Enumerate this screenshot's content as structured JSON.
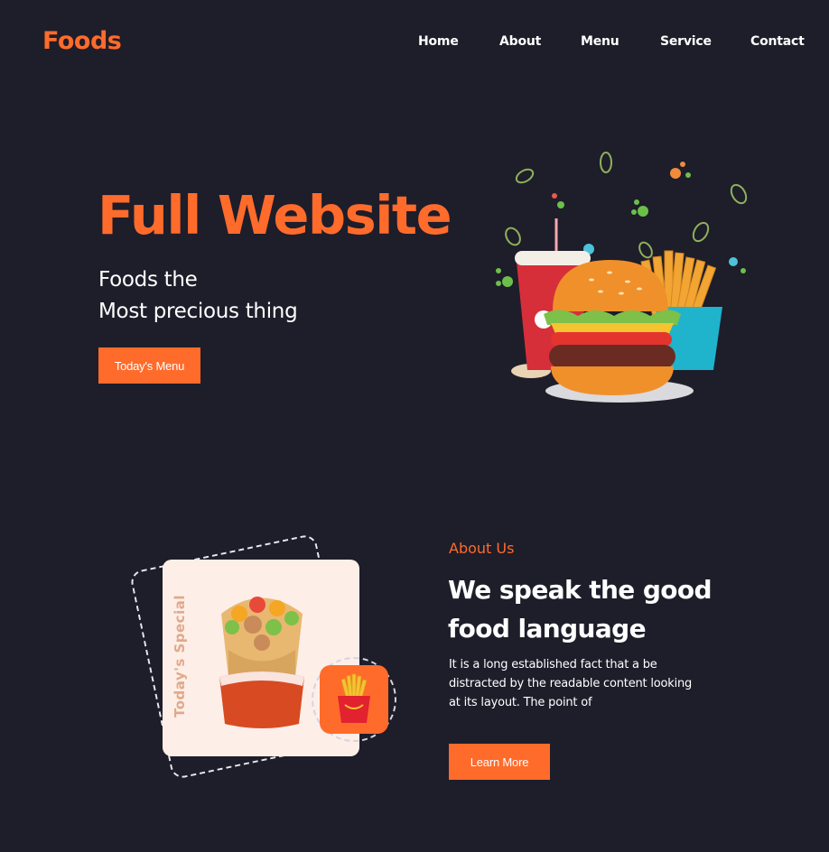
{
  "header": {
    "logo": "Foods",
    "nav": [
      "Home",
      "About",
      "Menu",
      "Service",
      "Contact"
    ]
  },
  "hero": {
    "title": "Full Website",
    "subtitle_line1": "Foods the",
    "subtitle_line2": "Most precious thing",
    "button": "Today's Menu",
    "image": "burger-fries-drink-illustration"
  },
  "about": {
    "special_label": "Today's Special",
    "special_image": "wrap-illustration",
    "badge_image": "fries-icon",
    "tag": "About Us",
    "title_line1": "We speak the good",
    "title_line2": "food language",
    "text": "It is a long established fact that a be distracted by the readable content looking at its layout. The point of",
    "button": "Learn More"
  },
  "colors": {
    "background": "#1e1d2a",
    "accent": "#ff6b2b",
    "card": "#fdeee8",
    "text": "#ffffff"
  }
}
